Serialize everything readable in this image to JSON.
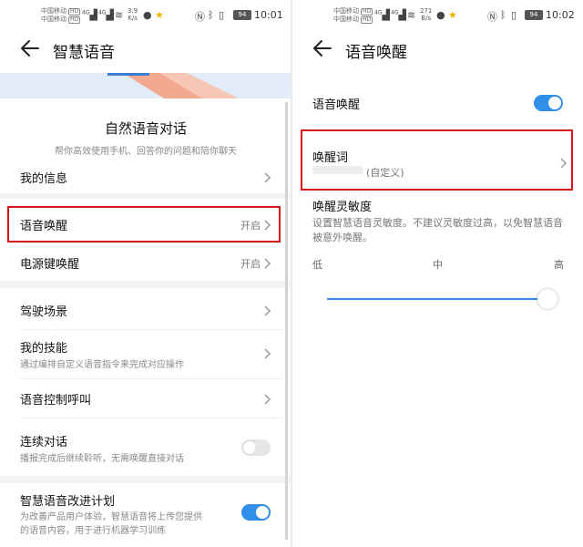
{
  "status_bar": {
    "carrier1": "中国移动",
    "carrier2": "中国移动",
    "hd": "HD",
    "signal1": "4G",
    "signal2": "4G",
    "left_speed_value": "3.9",
    "left_speed_unit": "K/s",
    "right_speed_value": "271",
    "right_speed_unit": "B/s",
    "battery": "94",
    "left_time": "10:01",
    "right_time": "10:02"
  },
  "left_screen": {
    "title": "智慧语音",
    "section_title": "自然语音对话",
    "section_desc": "帮你高效使用手机、回答你的问题和陪你聊天",
    "items": [
      {
        "label": "我的信息"
      },
      {
        "label": "语音唤醒",
        "value": "开启"
      },
      {
        "label": "电源键唤醒",
        "value": "开启"
      },
      {
        "label": "驾驶场景"
      },
      {
        "label": "我的技能",
        "sub": "通过编排自定义语音指令来完成对应操作"
      },
      {
        "label": "语音控制呼叫"
      },
      {
        "label": "连续对话",
        "sub": "播报完成后继续聆听，无需唤醒直接对话",
        "toggle": false
      },
      {
        "label": "智慧语音改进计划",
        "sub1": "为改善产品用户体验，智慧语音将上传您提供",
        "sub2": "的语音内容，用于进行机器学习训练",
        "toggle": true
      }
    ]
  },
  "right_screen": {
    "title": "语音唤醒",
    "voice_wake_label": "语音唤醒",
    "voice_wake_on": true,
    "wake_word_label": "唤醒词",
    "wake_word_value": "(自定义)",
    "sensitivity_label": "唤醒灵敏度",
    "sensitivity_desc": "设置智慧语音灵敏度。不建议灵敏度过高，以免智慧语音被意外唤醒。",
    "ticks": {
      "low": "低",
      "mid": "中",
      "high": "高"
    },
    "sensitivity_level": 1.0
  },
  "colors": {
    "accent": "#2f8fe9",
    "highlight": "#d7141a"
  }
}
